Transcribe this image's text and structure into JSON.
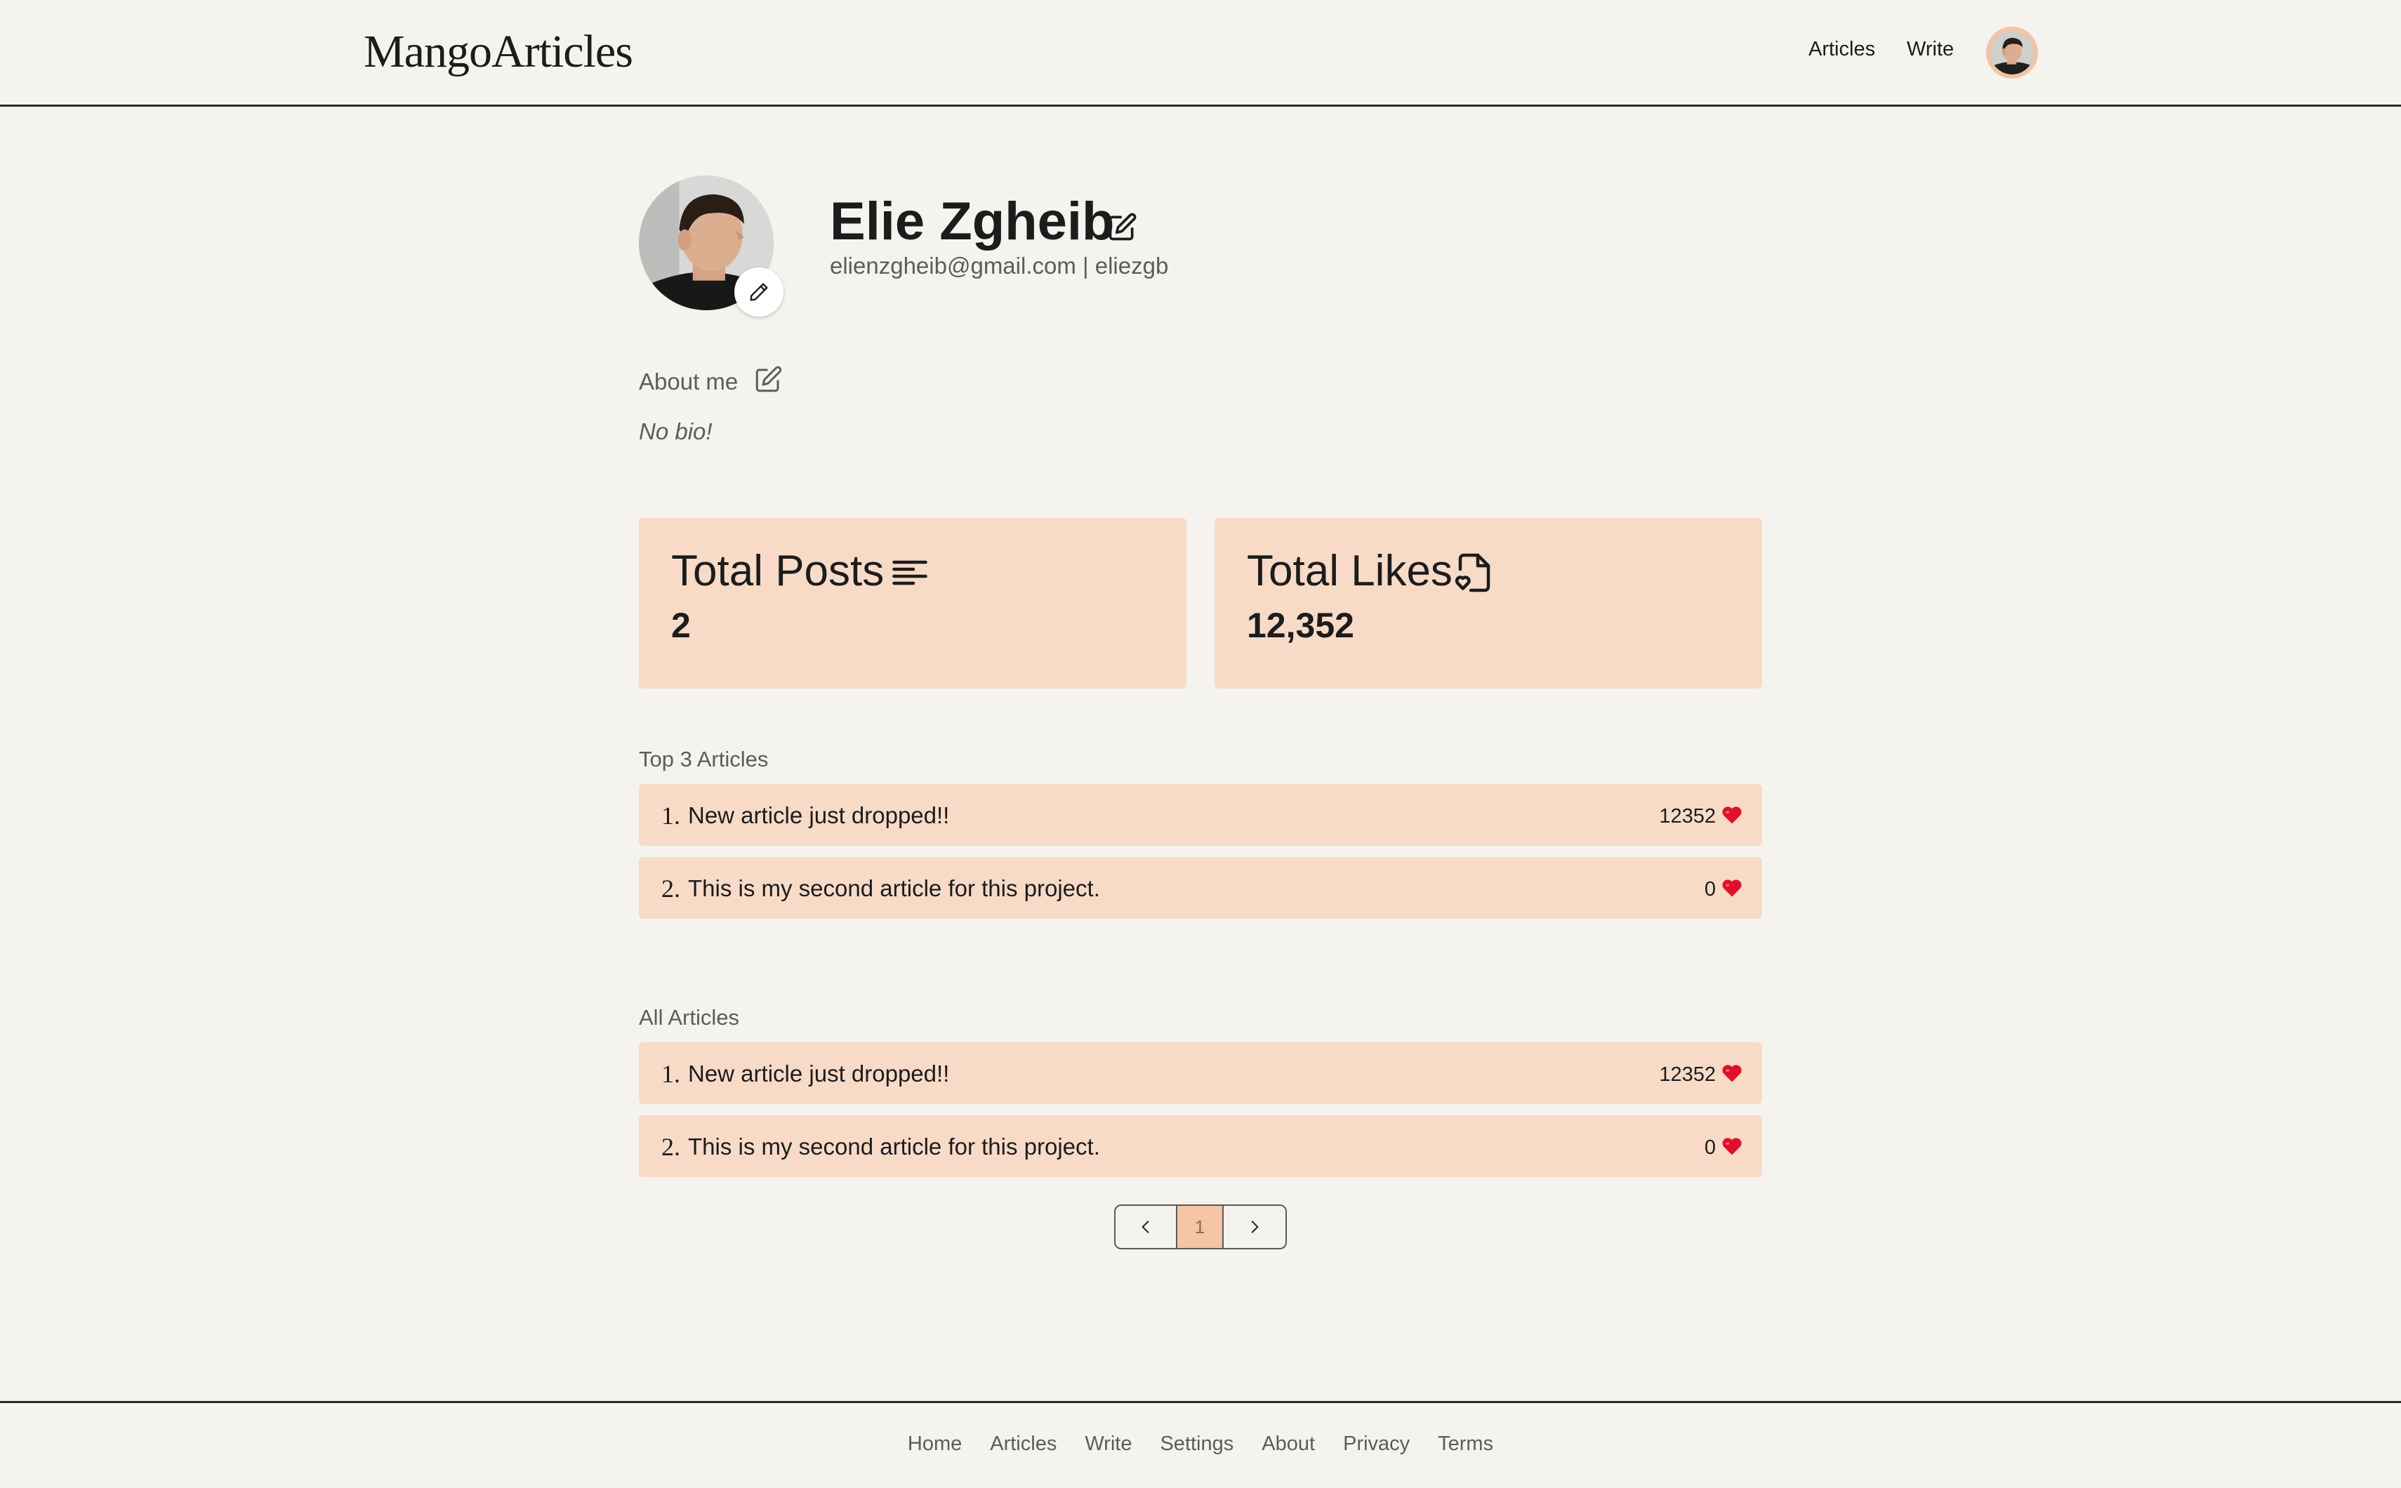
{
  "brand": {
    "logo": "MangoArticles"
  },
  "nav": {
    "articles": "Articles",
    "write": "Write"
  },
  "profile": {
    "name": "Elie Zgheib",
    "contact": "elienzgheib@gmail.com | eliezgb",
    "about_label": "About me",
    "bio": "No bio!"
  },
  "stats": {
    "posts": {
      "title": "Total Posts",
      "value": "2",
      "icon": "list-icon"
    },
    "likes": {
      "title": "Total Likes",
      "value": "12,352",
      "icon": "file-heart-icon"
    }
  },
  "top_articles": {
    "label": "Top 3 Articles",
    "items": [
      {
        "num": "1.",
        "title": "New article just dropped!!",
        "likes": "12352"
      },
      {
        "num": "2.",
        "title": "This is my second article for this project.",
        "likes": "0"
      }
    ]
  },
  "all_articles": {
    "label": "All Articles",
    "items": [
      {
        "num": "1.",
        "title": "New article just dropped!!",
        "likes": "12352"
      },
      {
        "num": "2.",
        "title": "This is my second article for this project.",
        "likes": "0"
      }
    ]
  },
  "pagination": {
    "current": "1"
  },
  "footer": {
    "links": [
      "Home",
      "Articles",
      "Write",
      "Settings",
      "About",
      "Privacy",
      "Terms"
    ]
  },
  "colors": {
    "background": "#f5f3ee",
    "card": "#f7dbc7",
    "accent": "#f5c3a6",
    "heart": "#e0102a"
  }
}
